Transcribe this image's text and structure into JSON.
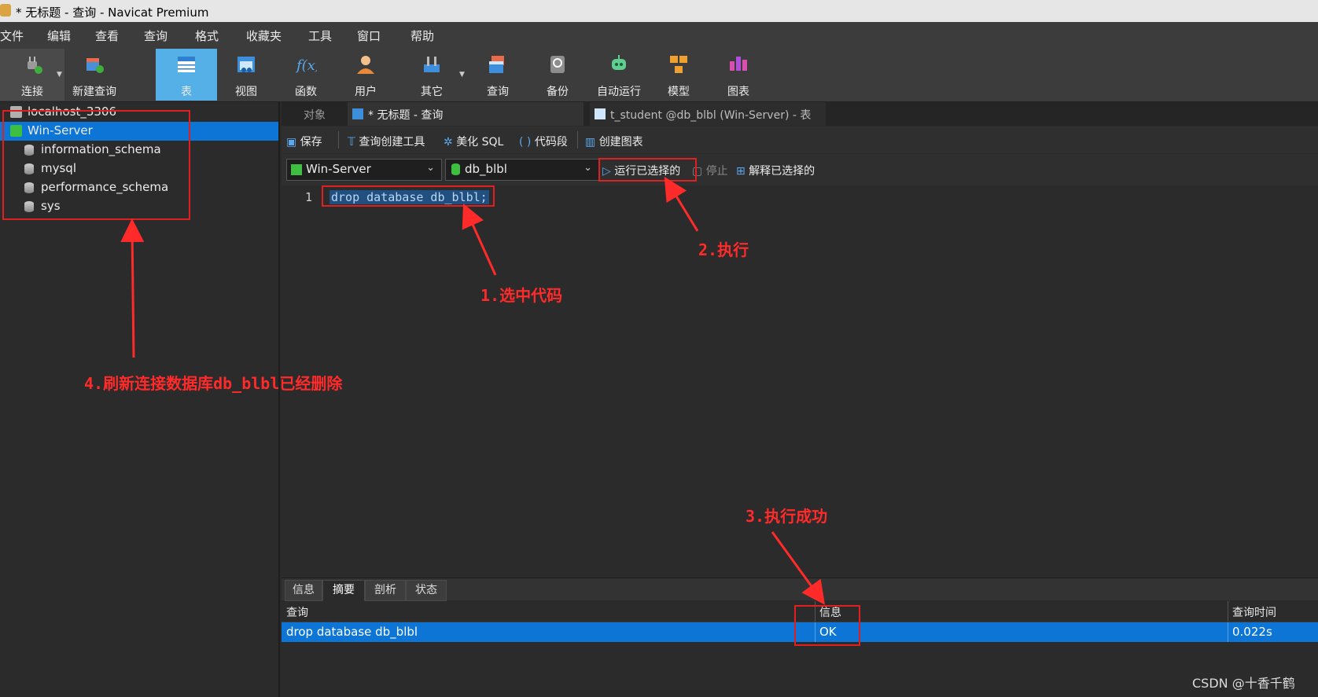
{
  "window": {
    "title": "* 无标题 - 查询 - Navicat Premium"
  },
  "menu": [
    "文件",
    "编辑",
    "查看",
    "查询",
    "格式",
    "收藏夹",
    "工具",
    "窗口",
    "帮助"
  ],
  "toolbar": {
    "connect": "连接",
    "new_query": "新建查询",
    "table": "表",
    "view": "视图",
    "function": "函数",
    "user": "用户",
    "other": "其它",
    "query": "查询",
    "backup": "备份",
    "automation": "自动运行",
    "model": "模型",
    "chart": "图表"
  },
  "sidebar": {
    "items": [
      {
        "label": "localhost_3306"
      },
      {
        "label": "Win-Server"
      },
      {
        "label": "information_schema"
      },
      {
        "label": "mysql"
      },
      {
        "label": "performance_schema"
      },
      {
        "label": "sys"
      }
    ]
  },
  "tabs": {
    "objects": "对象",
    "query": "* 无标题 - 查询",
    "table": "t_student @db_blbl (Win-Server) - 表"
  },
  "actions": {
    "save": "保存",
    "query_builder": "查询创建工具",
    "beautify": "美化 SQL",
    "snippet": "代码段",
    "create_chart": "创建图表"
  },
  "selectors": {
    "connection": "Win-Server",
    "database": "db_blbl",
    "run_selected": "运行已选择的",
    "stop": "停止",
    "explain_selected": "解释已选择的"
  },
  "editor": {
    "line_number": "1",
    "code": "drop database db_blbl;"
  },
  "result": {
    "tabs": [
      "信息",
      "摘要",
      "剖析",
      "状态"
    ],
    "headers": {
      "query": "查询",
      "info": "信息",
      "time": "查询时间"
    },
    "row": {
      "query": "drop database db_blbl",
      "info": "OK",
      "time": "0.022s"
    }
  },
  "annotations": {
    "step1": "1.选中代码",
    "step2": "2.执行",
    "step3": "3.执行成功",
    "step4": "4.刷新连接数据库db_blbl已经删除"
  },
  "watermark": "CSDN @十香千鹤",
  "colors": {
    "selection": "#0c75d6",
    "annotation": "#ff2a2a",
    "active_tool": "#55b0e8"
  }
}
